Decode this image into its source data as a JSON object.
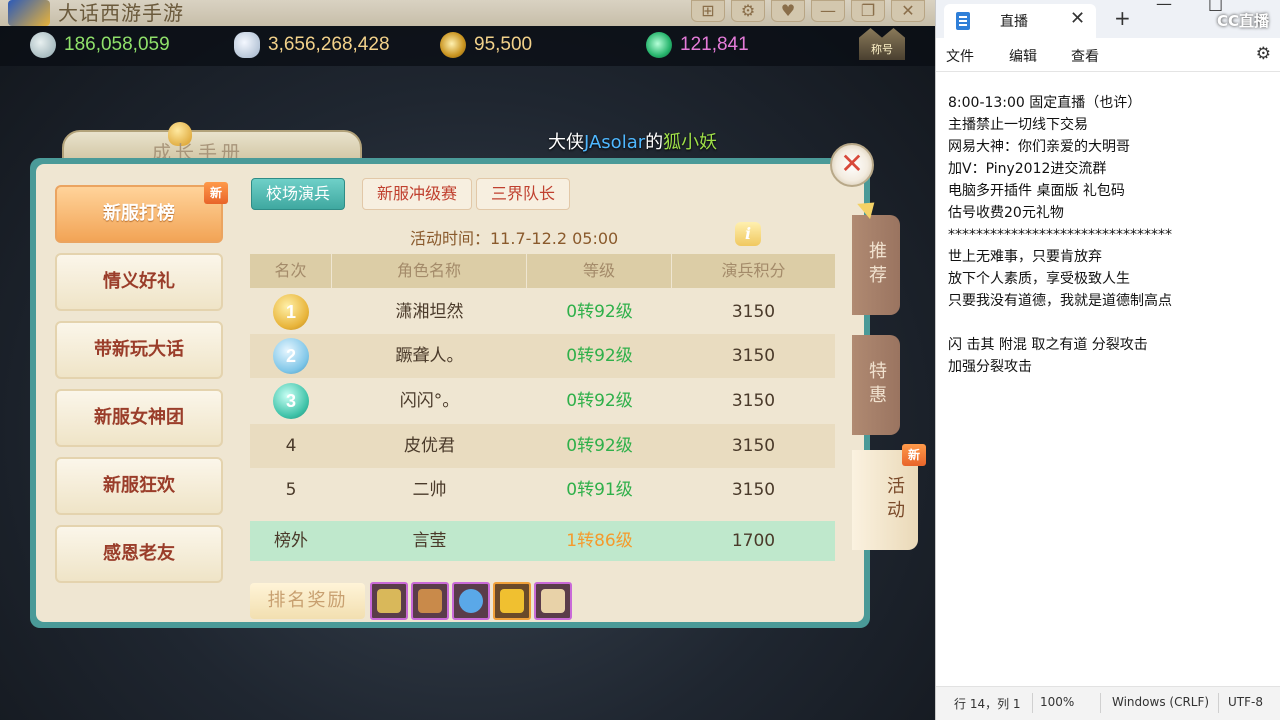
{
  "game": {
    "app_title": "大话西游手游",
    "currencies": [
      {
        "icon": "xianyu-icon",
        "value": "186,058,059",
        "color": "#8fe06a"
      },
      {
        "icon": "silver-icon",
        "value": "3,656,268,428",
        "color": "#f2d18a"
      },
      {
        "icon": "coin-icon",
        "value": "95,500",
        "color": "#f2d18a"
      },
      {
        "icon": "jade-icon",
        "value": "121,841",
        "color": "#e47bd8"
      }
    ],
    "rank_badge": "称号",
    "panel_title": "成长手册",
    "marquee": {
      "prefix": "大侠",
      "user": "JAsolar",
      "mid": "的",
      "item": "狐小妖"
    },
    "close_label": "✕",
    "menu": [
      {
        "label": "新服打榜",
        "active": true,
        "badge": "新"
      },
      {
        "label": "情义好礼"
      },
      {
        "label": "带新玩大话"
      },
      {
        "label": "新服女神团"
      },
      {
        "label": "新服狂欢"
      },
      {
        "label": "感恩老友"
      }
    ],
    "subtabs": [
      "校场演兵",
      "新服冲级赛",
      "三界队长"
    ],
    "activity_time": "活动时间：11.7-12.2  05:00",
    "info_label": "i",
    "table": {
      "headers": [
        "名次",
        "角色名称",
        "等级",
        "演兵积分"
      ],
      "rows": [
        {
          "rank": "1",
          "name": "潇湘坦然",
          "level": "0转92级",
          "score": "3150"
        },
        {
          "rank": "2",
          "name": "蹶聋人。",
          "level": "0转92级",
          "score": "3150"
        },
        {
          "rank": "3",
          "name": "闪闪°。",
          "level": "0转92级",
          "score": "3150"
        },
        {
          "rank": "4",
          "name": "皮优君",
          "level": "0转92级",
          "score": "3150"
        },
        {
          "rank": "5",
          "name": "二帅",
          "level": "0转91级",
          "score": "3150"
        }
      ],
      "self_row": {
        "rank": "榜外",
        "name": "言莹",
        "level": "1转86级",
        "score": "1700"
      }
    },
    "reward_label": "排名奖励",
    "side_tabs": [
      {
        "label": "推荐"
      },
      {
        "label": "特惠"
      },
      {
        "label": "活动",
        "badge": "新"
      }
    ]
  },
  "notepad": {
    "tab_title": "直播",
    "new_tab": "+",
    "watermark": "CC直播",
    "menus": [
      "文件",
      "编辑",
      "查看"
    ],
    "lines": [
      "8:00-13:00 固定直播（也许）",
      "主播禁止一切线下交易",
      "网易大神：你们亲爱的大明哥",
      "加V：Piny2012进交流群",
      "电脑多开插件 桌面版 礼包码",
      "估号收费20元礼物",
      "********************************",
      "世上无难事，只要肯放弃",
      "放下个人素质，享受极致人生",
      "只要我没有道德，我就是道德制高点",
      "",
      "闪 击其 附混 取之有道 分裂攻击",
      "加强分裂攻击"
    ],
    "status": {
      "position": "行 14，列 1",
      "zoom": "100%",
      "line_ending": "Windows (CRLF)",
      "encoding": "UTF-8"
    }
  }
}
